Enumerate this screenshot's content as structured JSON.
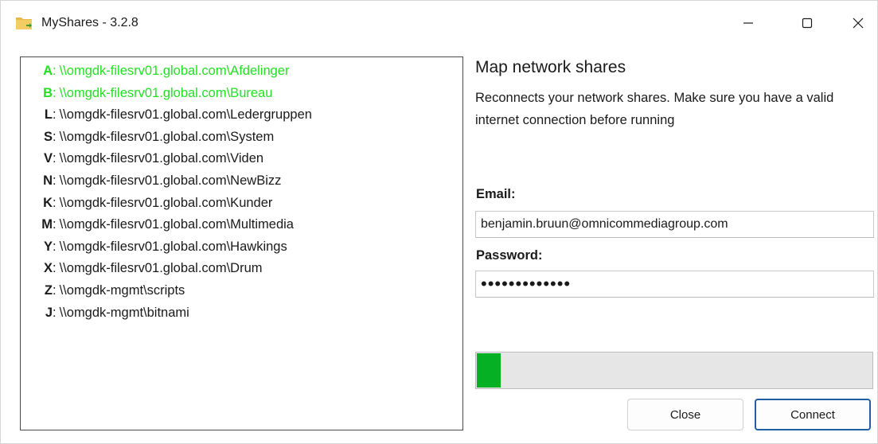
{
  "window": {
    "title": "MyShares - 3.2.8",
    "icon": "folder-icon",
    "caption_buttons": [
      "minimize-icon",
      "maximize-icon",
      "close-icon"
    ]
  },
  "drives": [
    {
      "letter": "A",
      "path": "\\\\omgdk-filesrv01.global.com\\Afdelinger",
      "connected": true
    },
    {
      "letter": "B",
      "path": "\\\\omgdk-filesrv01.global.com\\Bureau",
      "connected": true
    },
    {
      "letter": "L",
      "path": "\\\\omgdk-filesrv01.global.com\\Ledergruppen",
      "connected": false
    },
    {
      "letter": "S",
      "path": "\\\\omgdk-filesrv01.global.com\\System",
      "connected": false
    },
    {
      "letter": "V",
      "path": "\\\\omgdk-filesrv01.global.com\\Viden",
      "connected": false
    },
    {
      "letter": "N",
      "path": "\\\\omgdk-filesrv01.global.com\\NewBizz",
      "connected": false
    },
    {
      "letter": "K",
      "path": "\\\\omgdk-filesrv01.global.com\\Kunder",
      "connected": false
    },
    {
      "letter": "M",
      "path": "\\\\omgdk-filesrv01.global.com\\Multimedia",
      "connected": false
    },
    {
      "letter": "Y",
      "path": "\\\\omgdk-filesrv01.global.com\\Hawkings",
      "connected": false
    },
    {
      "letter": "X",
      "path": "\\\\omgdk-filesrv01.global.com\\Drum",
      "connected": false
    },
    {
      "letter": "Z",
      "path": "\\\\omgdk-mgmt\\scripts",
      "connected": false
    },
    {
      "letter": "J",
      "path": "\\\\omgdk-mgmt\\bitnami",
      "connected": false
    }
  ],
  "panel": {
    "heading": "Map network shares",
    "description": "Reconnects your network shares. Make sure you have a valid internet connection before running",
    "email_label": "Email:",
    "email_value": "benjamin.bruun@omnicommediagroup.com",
    "password_label": "Password:",
    "password_value": "•••••••••••••",
    "progress": 0.06
  },
  "buttons": {
    "close_label": "Close",
    "connect_label": "Connect"
  },
  "colors": {
    "connected_text": "#23e023",
    "progress_fill": "#06b025",
    "accent_border": "#1f5fa8"
  }
}
